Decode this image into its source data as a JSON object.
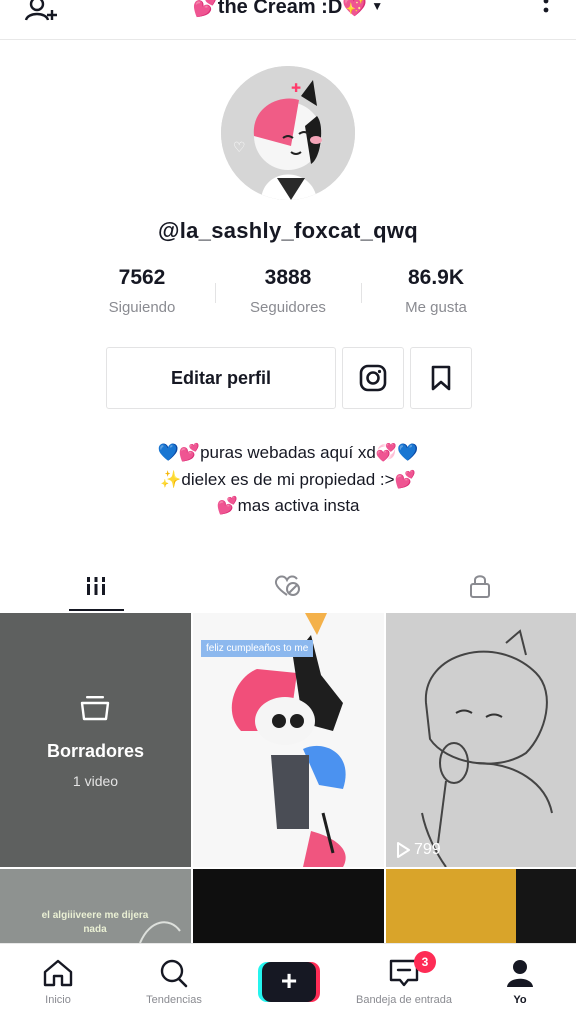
{
  "header": {
    "title": "💕the Cream :D💖"
  },
  "profile": {
    "username": "@la_sashly_foxcat_qwq",
    "stats": [
      {
        "value": "7562",
        "label": "Siguiendo"
      },
      {
        "value": "3888",
        "label": "Seguidores"
      },
      {
        "value": "86.9K",
        "label": "Me gusta"
      }
    ],
    "edit_button": "Editar perfil",
    "bio": [
      "💙💕puras webadas aquí xd💞💙",
      "✨dielex es de mi propiedad :>💕",
      "💕mas activa insta"
    ]
  },
  "grid": {
    "drafts_title": "Borradores",
    "drafts_count": "1 video",
    "video1_caption": "feliz cumpleaños to me",
    "video2_views": "799",
    "video3_caption": "el algiiiveere me dijera nada"
  },
  "nav": {
    "items": [
      {
        "label": "Inicio",
        "icon": "home-icon"
      },
      {
        "label": "Tendencias",
        "icon": "search-icon"
      },
      {
        "label": "",
        "icon": "plus-icon"
      },
      {
        "label": "Bandeja de entrada",
        "icon": "inbox-icon"
      },
      {
        "label": "Yo",
        "icon": "profile-icon"
      }
    ],
    "inbox_badge": "3"
  },
  "colors": {
    "accent_red": "#fe2c55",
    "accent_cyan": "#25f4ee",
    "text": "#161823",
    "muted": "#8a8b91"
  }
}
